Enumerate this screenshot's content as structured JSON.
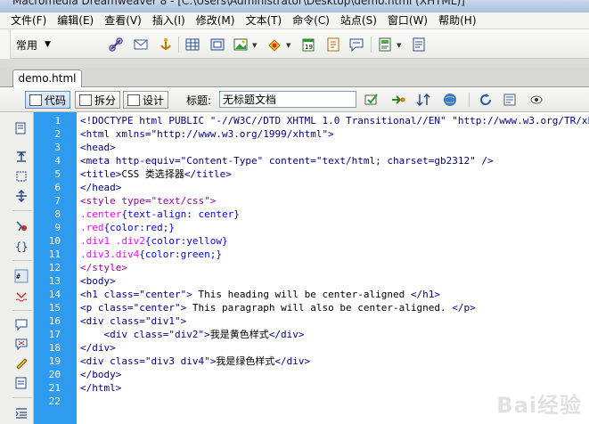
{
  "window": {
    "title": "Macromedia Dreamweaver 8 - [C:\\Users\\Administrator\\Desktop\\demo.html (XHTML)]"
  },
  "menu": [
    "文件(F)",
    "编辑(E)",
    "查看(V)",
    "插入(I)",
    "修改(M)",
    "文本(T)",
    "命令(C)",
    "站点(S)",
    "窗口(W)",
    "帮助(H)"
  ],
  "insert_bar": {
    "category": "常用"
  },
  "document": {
    "tab_label": "demo.html",
    "views": {
      "code": "代码",
      "split": "拆分",
      "design": "设计"
    },
    "title_label": "标题:",
    "title_value": "无标题文档"
  },
  "editor": {
    "lines": [
      {
        "n": "1",
        "tokens": [
          {
            "t": "<!DOCTYPE html PUBLIC \"-//W3C//DTD XHTML 1.0 Transitional//EN\" \"http://www.w3.org/TR/xh",
            "c": "tag"
          }
        ]
      },
      {
        "n": "2",
        "tokens": [
          {
            "t": "<html xmlns=\"http://www.w3.org/1999/xhtml\">",
            "c": "tag"
          }
        ]
      },
      {
        "n": "3",
        "tokens": [
          {
            "t": "<head>",
            "c": "tag"
          }
        ]
      },
      {
        "n": "4",
        "tokens": [
          {
            "t": "<meta http-equiv=\"Content-Type\" content=\"text/html; charset=gb2312\" />",
            "c": "tag"
          }
        ]
      },
      {
        "n": "5",
        "tokens": [
          {
            "t": "<title>",
            "c": "tag"
          },
          {
            "t": "CSS 类选择器",
            "c": "text"
          },
          {
            "t": "</title>",
            "c": "tag"
          }
        ]
      },
      {
        "n": "6",
        "tokens": [
          {
            "t": "</head>",
            "c": "tag"
          }
        ]
      },
      {
        "n": "7",
        "tokens": [
          {
            "t": "<style type=\"text/css\">",
            "c": "style"
          }
        ]
      },
      {
        "n": "8",
        "tokens": [
          {
            "t": ".center",
            "c": "selector"
          },
          {
            "t": "{text-align: center}",
            "c": "prop"
          }
        ]
      },
      {
        "n": "9",
        "tokens": [
          {
            "t": ".red",
            "c": "selector"
          },
          {
            "t": "{color:red;}",
            "c": "prop"
          }
        ]
      },
      {
        "n": "10",
        "tokens": [
          {
            "t": ".div1 .div2",
            "c": "selector"
          },
          {
            "t": "{color:yellow}",
            "c": "prop"
          }
        ]
      },
      {
        "n": "11",
        "tokens": [
          {
            "t": ".div3.div4",
            "c": "selector"
          },
          {
            "t": "{color:green;}",
            "c": "prop"
          }
        ]
      },
      {
        "n": "12",
        "tokens": [
          {
            "t": "</style>",
            "c": "style"
          }
        ]
      },
      {
        "n": "13",
        "tokens": [
          {
            "t": "<body>",
            "c": "tag"
          }
        ]
      },
      {
        "n": "14",
        "tokens": [
          {
            "t": "<h1 class=\"center\">",
            "c": "tag"
          },
          {
            "t": " This heading will be center-aligned ",
            "c": "text"
          },
          {
            "t": "</h1>",
            "c": "tag"
          }
        ]
      },
      {
        "n": "15",
        "tokens": [
          {
            "t": "<p class=\"center\">",
            "c": "tag"
          },
          {
            "t": " This paragraph will also be center-aligned. ",
            "c": "text"
          },
          {
            "t": "</p>",
            "c": "tag"
          }
        ]
      },
      {
        "n": "16",
        "tokens": [
          {
            "t": "<div class=\"div1\">",
            "c": "tag"
          }
        ]
      },
      {
        "n": "17",
        "tokens": [
          {
            "t": "    ",
            "c": "text"
          },
          {
            "t": "<div class=\"div2\">",
            "c": "tag"
          },
          {
            "t": "我是黄色样式",
            "c": "text"
          },
          {
            "t": "</div>",
            "c": "tag"
          }
        ]
      },
      {
        "n": "18",
        "tokens": [
          {
            "t": "</div>",
            "c": "tag"
          }
        ]
      },
      {
        "n": "19",
        "tokens": [
          {
            "t": "<div class=\"div3 div4\">",
            "c": "tag"
          },
          {
            "t": "我是绿色样式",
            "c": "text"
          },
          {
            "t": "</div>",
            "c": "tag"
          }
        ]
      },
      {
        "n": "20",
        "tokens": [
          {
            "t": "</body>",
            "c": "tag"
          }
        ]
      },
      {
        "n": "21",
        "tokens": [
          {
            "t": "</html>",
            "c": "tag"
          }
        ]
      },
      {
        "n": "22",
        "tokens": []
      }
    ]
  },
  "colors": {
    "tag": "#000088",
    "text": "#000000",
    "style": "#990099",
    "selector": "#ff00ff",
    "prop": "#0000ff",
    "gutter": "#2e9bef"
  },
  "watermark": "Bai经验"
}
